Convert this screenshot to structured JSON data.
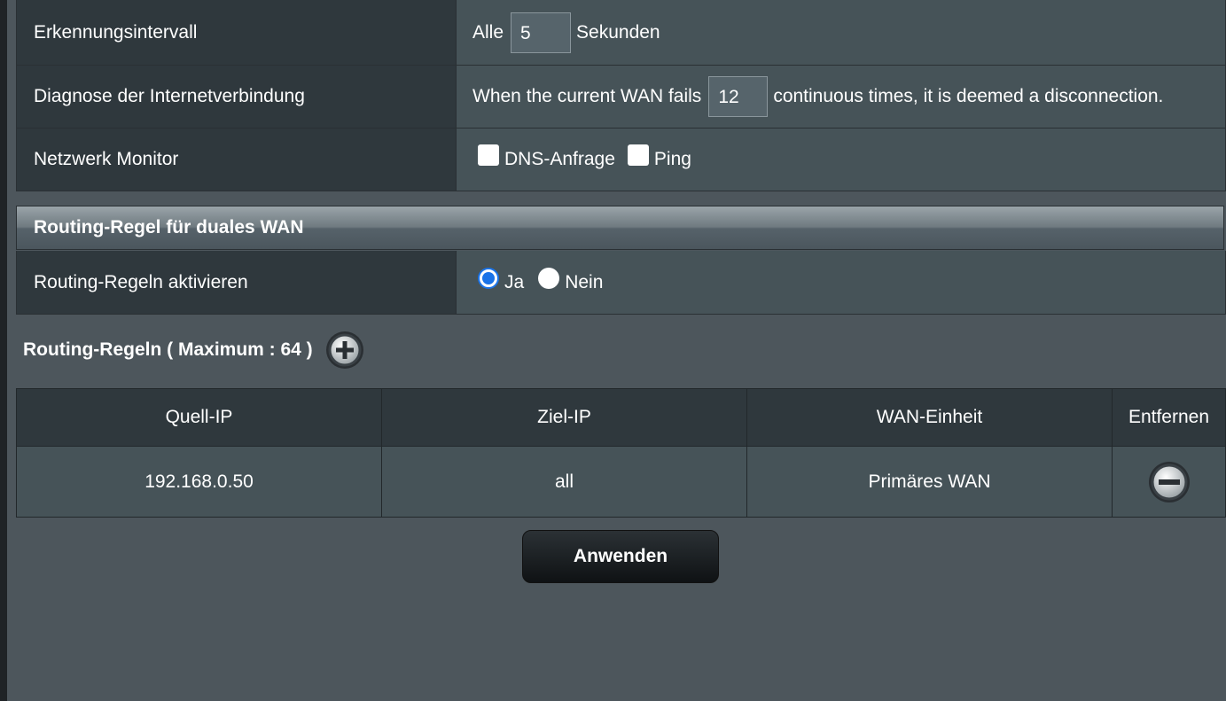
{
  "monitor": {
    "interval": {
      "label": "Erkennungsintervall",
      "prefix": "Alle",
      "value": "5",
      "suffix": "Sekunden"
    },
    "diagnosis": {
      "label": "Diagnose der Internetverbindung",
      "prefix": "When the current WAN fails",
      "value": "12",
      "suffix": "continuous times, it is deemed a disconnection."
    },
    "network_monitor": {
      "label": "Netzwerk Monitor",
      "options": [
        {
          "label": "DNS-Anfrage",
          "checked": false
        },
        {
          "label": "Ping",
          "checked": false
        }
      ]
    }
  },
  "routing_section": {
    "title": "Routing-Regel für duales WAN",
    "enable": {
      "label": "Routing-Regeln aktivieren",
      "options": [
        {
          "label": "Ja",
          "checked": true
        },
        {
          "label": "Nein",
          "checked": false
        }
      ]
    }
  },
  "rules": {
    "title": "Routing-Regeln ( Maximum : 64 )",
    "add_icon": "add-circle-icon",
    "columns": [
      "Quell-IP",
      "Ziel-IP",
      "WAN-Einheit",
      "Entfernen"
    ],
    "rows": [
      {
        "source_ip": "192.168.0.50",
        "dest_ip": "all",
        "wan_unit": "Primäres WAN",
        "remove_icon": "remove-circle-icon"
      }
    ]
  },
  "apply_button": "Anwenden"
}
